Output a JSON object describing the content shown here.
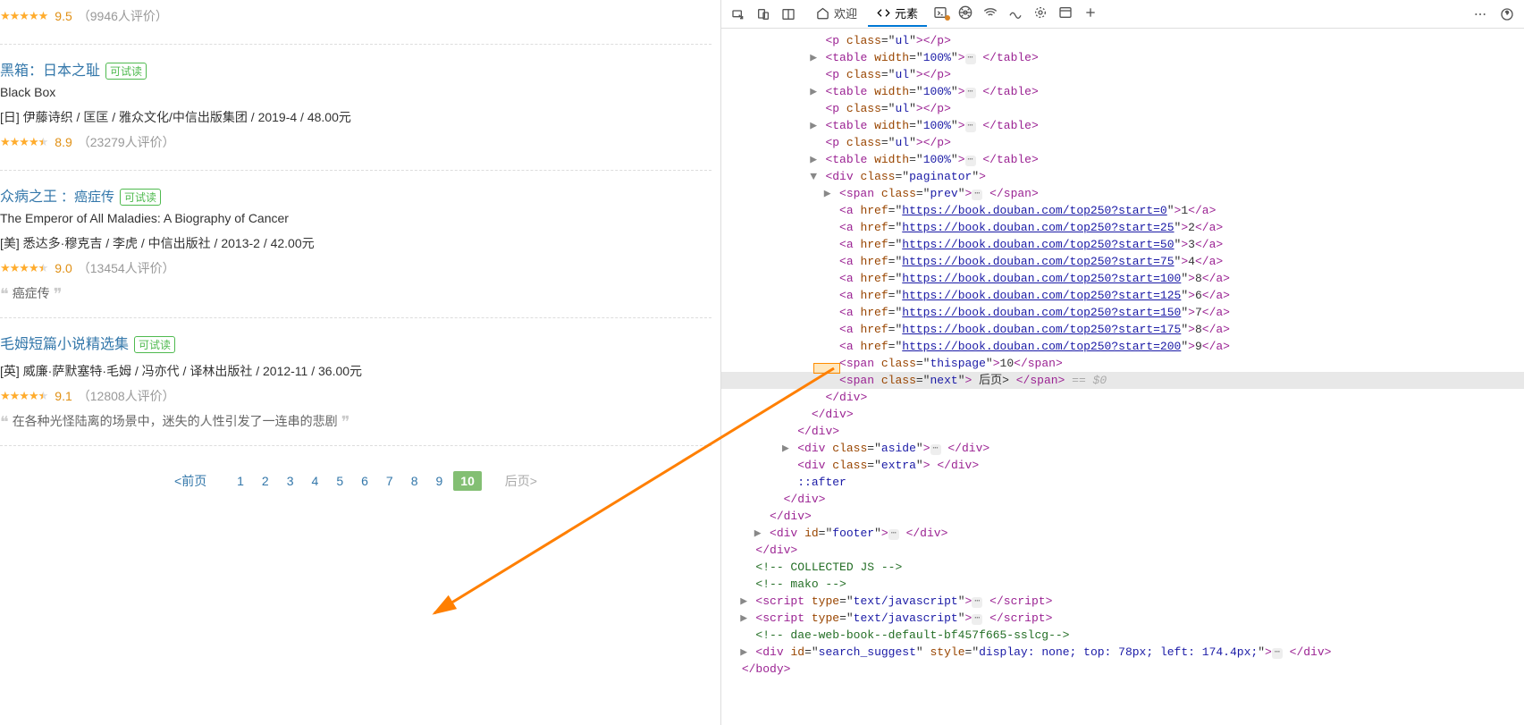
{
  "books": [
    {
      "rating": "9.5",
      "count": "（9946人评价）",
      "stars": 5,
      "half": false
    },
    {
      "title": "黑箱：日本之耻",
      "tryread": "可试读",
      "en": "Black Box",
      "meta": "[日] 伊藤诗织 / 匡匡 / 雅众文化/中信出版集团 / 2019-4 / 48.00元",
      "rating": "8.9",
      "count": "（23279人评价）",
      "stars": 4,
      "half": true
    },
    {
      "title": "众病之王",
      "subtitle": "：癌症传",
      "tryread": "可试读",
      "en": "The Emperor of All Maladies: A Biography of Cancer",
      "meta": "[美] 悉达多·穆克吉 / 李虎 / 中信出版社 / 2013-2 / 42.00元",
      "rating": "9.0",
      "count": "（13454人评价）",
      "stars": 4,
      "half": true,
      "quote": "癌症传"
    },
    {
      "title": "毛姆短篇小说精选集",
      "tryread": "可试读",
      "meta": "[英] 威廉·萨默塞特·毛姆 / 冯亦代 / 译林出版社 / 2012-11 / 36.00元",
      "rating": "9.1",
      "count": "（12808人评价）",
      "stars": 4,
      "half": true,
      "quote": "在各种光怪陆离的场景中，迷失的人性引发了一连串的悲剧"
    }
  ],
  "paginator": {
    "prev": "<前页",
    "pages": [
      "1",
      "2",
      "3",
      "4",
      "5",
      "6",
      "7",
      "8",
      "9",
      "10"
    ],
    "current": "10",
    "next": "后页>"
  },
  "toolbar": {
    "welcome": "欢迎",
    "elements": "元素"
  },
  "dom": {
    "lines": [
      {
        "indent": 6,
        "toggle": "",
        "html": "<span class='t-tag'>&lt;p</span> <span class='t-attr'>class</span>=\"<span class='t-value'>ul</span>\"<span class='t-tag'>&gt;&lt;/p&gt;</span>",
        "partial": true
      },
      {
        "indent": 6,
        "toggle": "▶",
        "html": "<span class='t-tag'>&lt;table</span> <span class='t-attr'>width</span>=\"<span class='t-value'>100%</span>\"<span class='t-tag'>&gt;</span><span class='ellip'>⋯</span> <span class='t-tag'>&lt;/table&gt;</span>"
      },
      {
        "indent": 6,
        "toggle": "",
        "html": "<span class='t-tag'>&lt;p</span> <span class='t-attr'>class</span>=\"<span class='t-value'>ul</span>\"<span class='t-tag'>&gt;&lt;/p&gt;</span>"
      },
      {
        "indent": 6,
        "toggle": "▶",
        "html": "<span class='t-tag'>&lt;table</span> <span class='t-attr'>width</span>=\"<span class='t-value'>100%</span>\"<span class='t-tag'>&gt;</span><span class='ellip'>⋯</span> <span class='t-tag'>&lt;/table&gt;</span>"
      },
      {
        "indent": 6,
        "toggle": "",
        "html": "<span class='t-tag'>&lt;p</span> <span class='t-attr'>class</span>=\"<span class='t-value'>ul</span>\"<span class='t-tag'>&gt;&lt;/p&gt;</span>"
      },
      {
        "indent": 6,
        "toggle": "▶",
        "html": "<span class='t-tag'>&lt;table</span> <span class='t-attr'>width</span>=\"<span class='t-value'>100%</span>\"<span class='t-tag'>&gt;</span><span class='ellip'>⋯</span> <span class='t-tag'>&lt;/table&gt;</span>"
      },
      {
        "indent": 6,
        "toggle": "",
        "html": "<span class='t-tag'>&lt;p</span> <span class='t-attr'>class</span>=\"<span class='t-value'>ul</span>\"<span class='t-tag'>&gt;&lt;/p&gt;</span>"
      },
      {
        "indent": 6,
        "toggle": "▶",
        "html": "<span class='t-tag'>&lt;table</span> <span class='t-attr'>width</span>=\"<span class='t-value'>100%</span>\"<span class='t-tag'>&gt;</span><span class='ellip'>⋯</span> <span class='t-tag'>&lt;/table&gt;</span>"
      },
      {
        "indent": 6,
        "toggle": "▼",
        "html": "<span class='t-tag'>&lt;div</span> <span class='t-attr'>class</span>=\"<span class='t-value'>paginator</span>\"<span class='t-tag'>&gt;</span>"
      },
      {
        "indent": 7,
        "toggle": "▶",
        "html": "<span class='t-tag'>&lt;span</span> <span class='t-attr'>class</span>=\"<span class='t-value'>prev</span>\"<span class='t-tag'>&gt;</span><span class='ellip'>⋯</span> <span class='t-tag'>&lt;/span&gt;</span>"
      },
      {
        "indent": 7,
        "toggle": "",
        "html": "<span class='t-tag'>&lt;a</span> <span class='t-attr'>href</span>=\"<span class='t-url'>https://book.douban.com/top250?start=0</span>\"<span class='t-tag'>&gt;</span>1<span class='t-tag'>&lt;/a&gt;</span>"
      },
      {
        "indent": 7,
        "toggle": "",
        "html": "<span class='t-tag'>&lt;a</span> <span class='t-attr'>href</span>=\"<span class='t-url'>https://book.douban.com/top250?start=25</span>\"<span class='t-tag'>&gt;</span>2<span class='t-tag'>&lt;/a&gt;</span>"
      },
      {
        "indent": 7,
        "toggle": "",
        "html": "<span class='t-tag'>&lt;a</span> <span class='t-attr'>href</span>=\"<span class='t-url'>https://book.douban.com/top250?start=50</span>\"<span class='t-tag'>&gt;</span>3<span class='t-tag'>&lt;/a&gt;</span>"
      },
      {
        "indent": 7,
        "toggle": "",
        "html": "<span class='t-tag'>&lt;a</span> <span class='t-attr'>href</span>=\"<span class='t-url'>https://book.douban.com/top250?start=75</span>\"<span class='t-tag'>&gt;</span>4<span class='t-tag'>&lt;/a&gt;</span>"
      },
      {
        "indent": 7,
        "toggle": "",
        "html": "<span class='t-tag'>&lt;a</span> <span class='t-attr'>href</span>=\"<span class='t-url'>https://book.douban.com/top250?start=100</span>\"<span class='t-tag'>&gt;</span>8<span class='t-tag'>&lt;/a&gt;</span>"
      },
      {
        "indent": 7,
        "toggle": "",
        "html": "<span class='t-tag'>&lt;a</span> <span class='t-attr'>href</span>=\"<span class='t-url'>https://book.douban.com/top250?start=125</span>\"<span class='t-tag'>&gt;</span>6<span class='t-tag'>&lt;/a&gt;</span>"
      },
      {
        "indent": 7,
        "toggle": "",
        "html": "<span class='t-tag'>&lt;a</span> <span class='t-attr'>href</span>=\"<span class='t-url'>https://book.douban.com/top250?start=150</span>\"<span class='t-tag'>&gt;</span>7<span class='t-tag'>&lt;/a&gt;</span>"
      },
      {
        "indent": 7,
        "toggle": "",
        "html": "<span class='t-tag'>&lt;a</span> <span class='t-attr'>href</span>=\"<span class='t-url'>https://book.douban.com/top250?start=175</span>\"<span class='t-tag'>&gt;</span>8<span class='t-tag'>&lt;/a&gt;</span>"
      },
      {
        "indent": 7,
        "toggle": "",
        "html": "<span class='t-tag'>&lt;a</span> <span class='t-attr'>href</span>=\"<span class='t-url'>https://book.douban.com/top250?start=200</span>\"<span class='t-tag'>&gt;</span>9<span class='t-tag'>&lt;/a&gt;</span>"
      },
      {
        "indent": 7,
        "toggle": "",
        "html": "<span class='t-tag'>&lt;span</span> <span class='t-attr'>class</span>=\"<span class='t-value'>thispage</span>\"<span class='t-tag'>&gt;</span>10<span class='t-tag'>&lt;/span&gt;</span>"
      },
      {
        "indent": 7,
        "toggle": "",
        "highlighted": true,
        "html": "<span class='t-tag'>&lt;span</span> <span class='t-attr'>class</span>=\"<span class='t-value'>next</span>\"<span class='t-tag'>&gt;</span> 后页&gt; <span class='t-tag'>&lt;/span&gt;</span> <span class='t-eq0'>== $0</span>"
      },
      {
        "indent": 6,
        "toggle": "",
        "html": "<span class='t-tag'>&lt;/div&gt;</span>"
      },
      {
        "indent": 5,
        "toggle": "",
        "html": "<span class='t-tag'>&lt;/div&gt;</span>"
      },
      {
        "indent": 4,
        "toggle": "",
        "html": "<span class='t-tag'>&lt;/div&gt;</span>"
      },
      {
        "indent": 4,
        "toggle": "▶",
        "html": "<span class='t-tag'>&lt;div</span> <span class='t-attr'>class</span>=\"<span class='t-value'>aside</span>\"<span class='t-tag'>&gt;</span><span class='ellip'>⋯</span> <span class='t-tag'>&lt;/div&gt;</span>"
      },
      {
        "indent": 4,
        "toggle": "",
        "html": "<span class='t-tag'>&lt;div</span> <span class='t-attr'>class</span>=\"<span class='t-value'>extra</span>\"<span class='t-tag'>&gt;</span> <span class='t-tag'>&lt;/div&gt;</span>"
      },
      {
        "indent": 4,
        "toggle": "",
        "html": "<span class='t-value'>::after</span>"
      },
      {
        "indent": 3,
        "toggle": "",
        "html": "<span class='t-tag'>&lt;/div&gt;</span>"
      },
      {
        "indent": 2,
        "toggle": "",
        "html": "<span class='t-tag'>&lt;/div&gt;</span>"
      },
      {
        "indent": 2,
        "toggle": "▶",
        "html": "<span class='t-tag'>&lt;div</span> <span class='t-attr'>id</span>=\"<span class='t-value'>footer</span>\"<span class='t-tag'>&gt;</span><span class='ellip'>⋯</span> <span class='t-tag'>&lt;/div&gt;</span>"
      },
      {
        "indent": 1,
        "toggle": "",
        "html": "<span class='t-tag'>&lt;/div&gt;</span>"
      },
      {
        "indent": 1,
        "toggle": "",
        "html": "<span class='t-comment'>&lt;!-- COLLECTED JS --&gt;</span>"
      },
      {
        "indent": 1,
        "toggle": "",
        "html": "<span class='t-comment'>&lt;!-- mako --&gt;</span>"
      },
      {
        "indent": 1,
        "toggle": "▶",
        "html": "<span class='t-tag'>&lt;script</span> <span class='t-attr'>type</span>=\"<span class='t-value'>text/javascript</span>\"<span class='t-tag'>&gt;</span><span class='ellip'>⋯</span> <span class='t-tag'>&lt;/script&gt;</span>"
      },
      {
        "indent": 1,
        "toggle": "▶",
        "html": "<span class='t-tag'>&lt;script</span> <span class='t-attr'>type</span>=\"<span class='t-value'>text/javascript</span>\"<span class='t-tag'>&gt;</span><span class='ellip'>⋯</span> <span class='t-tag'>&lt;/script&gt;</span>"
      },
      {
        "indent": 1,
        "toggle": "",
        "html": "<span class='t-comment'>&lt;!-- dae-web-book--default-bf457f665-sslcg--&gt;</span>"
      },
      {
        "indent": 1,
        "toggle": "▶",
        "html": "<span class='t-tag'>&lt;div</span> <span class='t-attr'>id</span>=\"<span class='t-value'>search_suggest</span>\" <span class='t-attr'>style</span>=\"<span class='t-value'>display: none; top: 78px; left: 174.4px;</span>\"<span class='t-tag'>&gt;</span><span class='ellip'>⋯</span> <span class='t-tag'>&lt;/div&gt;</span>"
      },
      {
        "indent": 0,
        "toggle": "",
        "html": "<span class='t-tag'>&lt;/body&gt;</span>"
      }
    ]
  }
}
